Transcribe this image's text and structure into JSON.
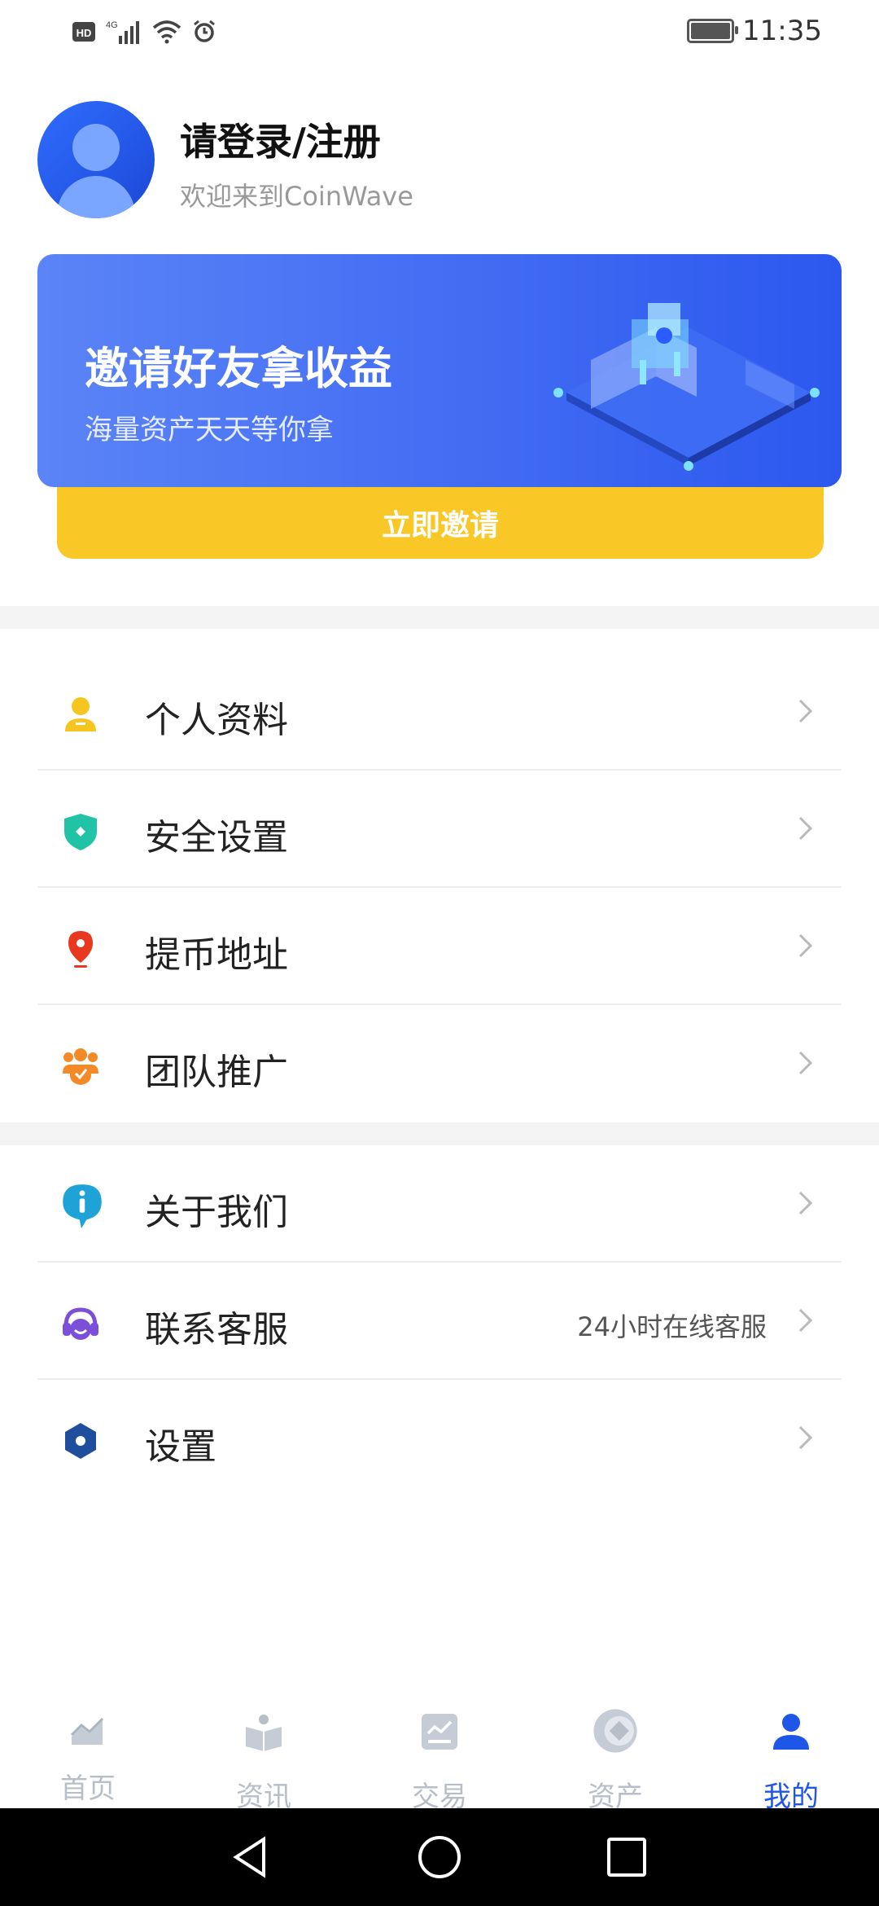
{
  "status_bar": {
    "left_text": "HD 46",
    "time": "11:35"
  },
  "profile": {
    "title": "请登录/注册",
    "subtitle": "欢迎来到CoinWave"
  },
  "banner": {
    "title": "邀请好友拿收益",
    "subtitle": "海量资产天天等你拿",
    "button_label": "立即邀请"
  },
  "menu_groups": [
    [
      {
        "label": "个人资料",
        "icon": "user-icon",
        "color": "#f7c51f"
      },
      {
        "label": "安全设置",
        "icon": "shield-icon",
        "color": "#20c3a6"
      },
      {
        "label": "提币地址",
        "icon": "location-pin-icon",
        "color": "#e8381f"
      },
      {
        "label": "团队推广",
        "icon": "team-icon",
        "color": "#f48a27"
      }
    ],
    [
      {
        "label": "关于我们",
        "icon": "info-icon",
        "color": "#1fa3d6"
      },
      {
        "label": "联系客服",
        "icon": "headset-icon",
        "color": "#7b4fd8",
        "value": "24小时在线客服"
      },
      {
        "label": "设置",
        "icon": "settings-hex-icon",
        "color": "#1f4f9c"
      }
    ]
  ],
  "tabs": [
    {
      "label": "首页",
      "icon": "chart-trend-icon",
      "active": false
    },
    {
      "label": "资讯",
      "icon": "news-book-icon",
      "active": false
    },
    {
      "label": "交易",
      "icon": "trade-icon",
      "active": false
    },
    {
      "label": "资产",
      "icon": "coin-icon",
      "active": false
    },
    {
      "label": "我的",
      "icon": "profile-icon",
      "active": true
    }
  ],
  "colors": {
    "accent": "#1e56e8",
    "invite_button": "#f9c726",
    "banner_start": "#5b84f7",
    "banner_end": "#2c58ef"
  }
}
